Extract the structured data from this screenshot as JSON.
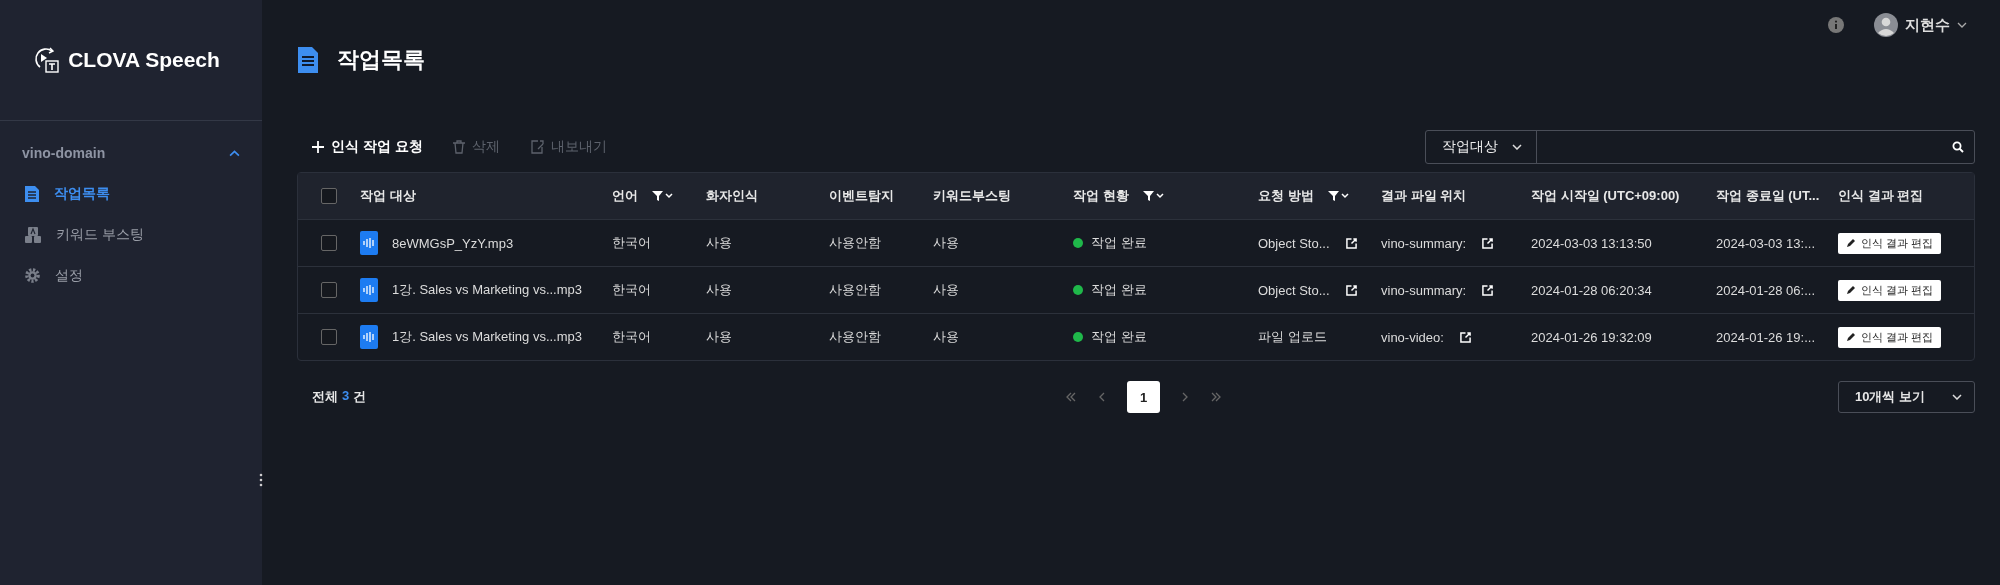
{
  "app": {
    "name": "CLOVA Speech"
  },
  "sidebar": {
    "workspace": "vino-domain",
    "expanded": true,
    "items": [
      {
        "label": "작업목록",
        "kind": "list",
        "selected": true
      },
      {
        "label": "키워드 부스팅",
        "kind": "keyword",
        "selected": false
      },
      {
        "label": "설정",
        "kind": "settings",
        "selected": false
      }
    ]
  },
  "header": {
    "user": "지현수"
  },
  "page": {
    "title": "작업목록"
  },
  "toolbar": {
    "actions": [
      {
        "label": "인식 작업 요청",
        "kind": "add",
        "disabled": false
      },
      {
        "label": "삭제",
        "kind": "delete",
        "disabled": true
      },
      {
        "label": "내보내기",
        "kind": "export",
        "disabled": true
      }
    ],
    "search_scope": "작업대상"
  },
  "table": {
    "select_all_checked": false,
    "columns": [
      {
        "label": "작업 대상",
        "filter": false
      },
      {
        "label": "언어",
        "filter": true
      },
      {
        "label": "화자인식",
        "filter": false
      },
      {
        "label": "이벤트탐지",
        "filter": false
      },
      {
        "label": "키워드부스팅",
        "filter": false
      },
      {
        "label": "작업 현황",
        "filter": true
      },
      {
        "label": "요청 방법",
        "filter": true
      },
      {
        "label": "결과 파일 위치",
        "filter": false
      },
      {
        "label": "작업 시작일 (UTC+09:00)",
        "filter": false
      },
      {
        "label": "작업 종료일 (UT...",
        "filter": false
      },
      {
        "label": "인식 결과 편집",
        "filter": false
      }
    ],
    "rows": [
      {
        "checked": false,
        "file": "8eWMGsP_YzY.mp3",
        "language": "한국어",
        "speaker": "사용",
        "event": "사용안함",
        "keyword": "사용",
        "status": "작업 완료",
        "color": "#1fb84a",
        "method": "Object Sto...",
        "method_link": true,
        "result": "vino-summary:",
        "started": "2024-03-03 13:13:50",
        "ended": "2024-03-03 13:...",
        "edit": "인식 결과 편집"
      },
      {
        "checked": false,
        "file": "1강. Sales vs Marketing vs...mp3",
        "language": "한국어",
        "speaker": "사용",
        "event": "사용안함",
        "keyword": "사용",
        "status": "작업 완료",
        "color": "#1fb84a",
        "method": "Object Sto...",
        "method_link": true,
        "result": "vino-summary:",
        "started": "2024-01-28 06:20:34",
        "ended": "2024-01-28 06:...",
        "edit": "인식 결과 편집"
      },
      {
        "checked": false,
        "file": "1강. Sales vs Marketing vs...mp3",
        "language": "한국어",
        "speaker": "사용",
        "event": "사용안함",
        "keyword": "사용",
        "status": "작업 완료",
        "color": "#1fb84a",
        "method": "파일 업로드",
        "method_link": false,
        "result": "vino-video:",
        "started": "2024-01-26 19:32:09",
        "ended": "2024-01-26 19:...",
        "edit": "인식 결과 편집"
      }
    ]
  },
  "footer": {
    "total_label": "전체",
    "total_count": "3",
    "total_unit": "건",
    "pages": [
      {
        "label": "1",
        "selected": true
      }
    ],
    "page_size": "10개씩 보기"
  }
}
